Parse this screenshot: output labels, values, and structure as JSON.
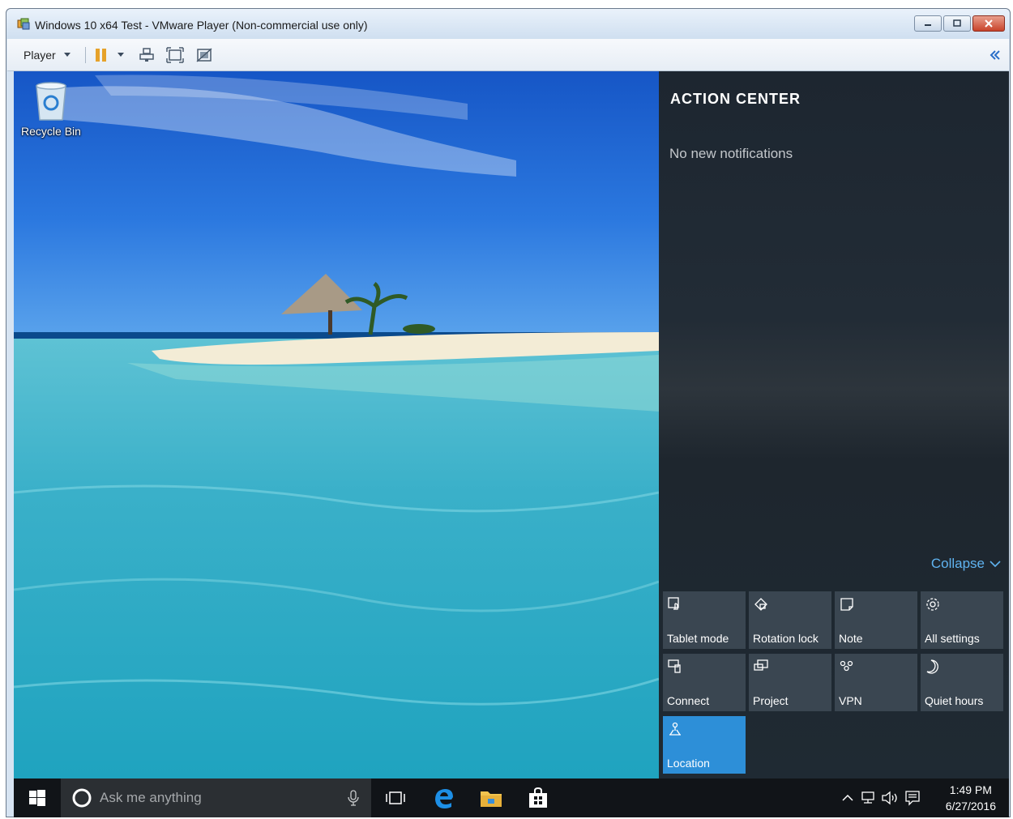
{
  "window": {
    "title": "Windows 10 x64 Test - VMware Player (Non-commercial use only)"
  },
  "toolbar": {
    "player_label": "Player"
  },
  "desktop": {
    "recycle_bin_label": "Recycle Bin"
  },
  "action_center": {
    "title": "ACTION CENTER",
    "empty_message": "No new notifications",
    "collapse_label": "Collapse",
    "accent_color": "#2d8fd8",
    "tiles": [
      {
        "label": "Tablet mode",
        "icon": "tablet-mode-icon",
        "active": false
      },
      {
        "label": "Rotation lock",
        "icon": "rotation-lock-icon",
        "active": false
      },
      {
        "label": "Note",
        "icon": "note-icon",
        "active": false
      },
      {
        "label": "All settings",
        "icon": "settings-gear-icon",
        "active": false
      },
      {
        "label": "Connect",
        "icon": "connect-icon",
        "active": false
      },
      {
        "label": "Project",
        "icon": "project-icon",
        "active": false
      },
      {
        "label": "VPN",
        "icon": "vpn-icon",
        "active": false
      },
      {
        "label": "Quiet hours",
        "icon": "moon-icon",
        "active": false
      },
      {
        "label": "Location",
        "icon": "location-icon",
        "active": true
      }
    ]
  },
  "taskbar": {
    "search_placeholder": "Ask me anything",
    "clock_time": "1:49 PM",
    "clock_date": "6/27/2016"
  }
}
